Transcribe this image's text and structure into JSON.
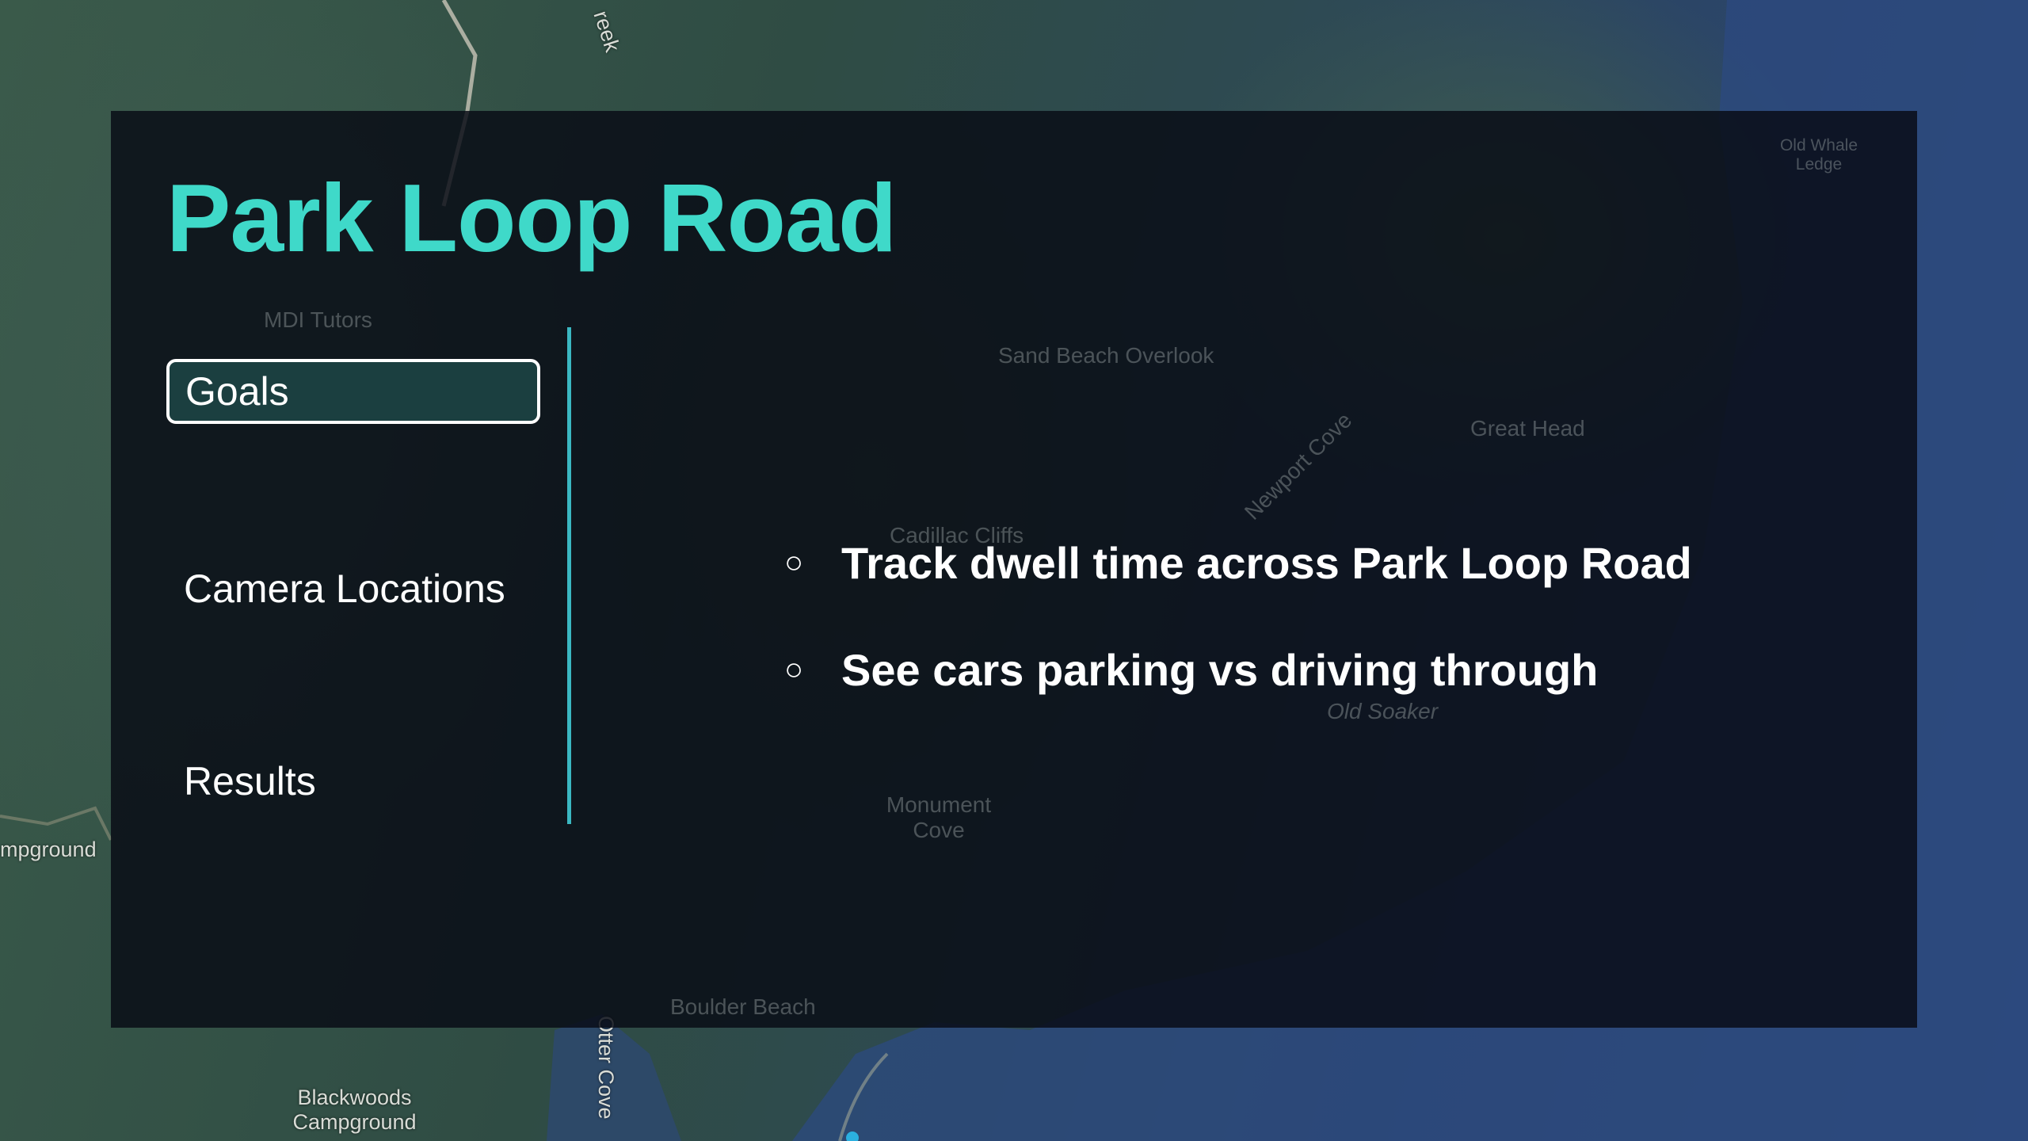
{
  "slide": {
    "title": "Park Loop Road",
    "accent_color": "#3fd9c9",
    "divider_color": "#3bb8c2",
    "active_item_bg": "#1b3f40"
  },
  "nav": {
    "items": [
      {
        "label": "Goals",
        "active": true
      },
      {
        "label": "Camera Locations",
        "active": false
      },
      {
        "label": "Results",
        "active": false
      }
    ]
  },
  "content": {
    "bullet_icon": "hollow-circle",
    "bullets": [
      "Track dwell time across Park Loop Road",
      "See cars parking vs driving through"
    ]
  },
  "map": {
    "labels": {
      "creek": "reek",
      "campground_left": "mpground",
      "blackwoods_line1": "Blackwoods",
      "blackwoods_line2": "Campground",
      "otter_cove": "Otter Cove",
      "mdi_tutors": "MDI Tutors",
      "sand_beach_overlook": "Sand Beach Overlook",
      "great_head": "Great Head",
      "newport_cove": "Newport Cove",
      "cadillac_cliffs": "Cadillac Cliffs",
      "old_soaker": "Old Soaker",
      "monument_cove_line1": "Monument",
      "monument_cove_line2": "Cove",
      "boulder_beach": "Boulder Beach",
      "old_whale_line1": "Old Whale",
      "old_whale_line2": "Ledge"
    }
  }
}
